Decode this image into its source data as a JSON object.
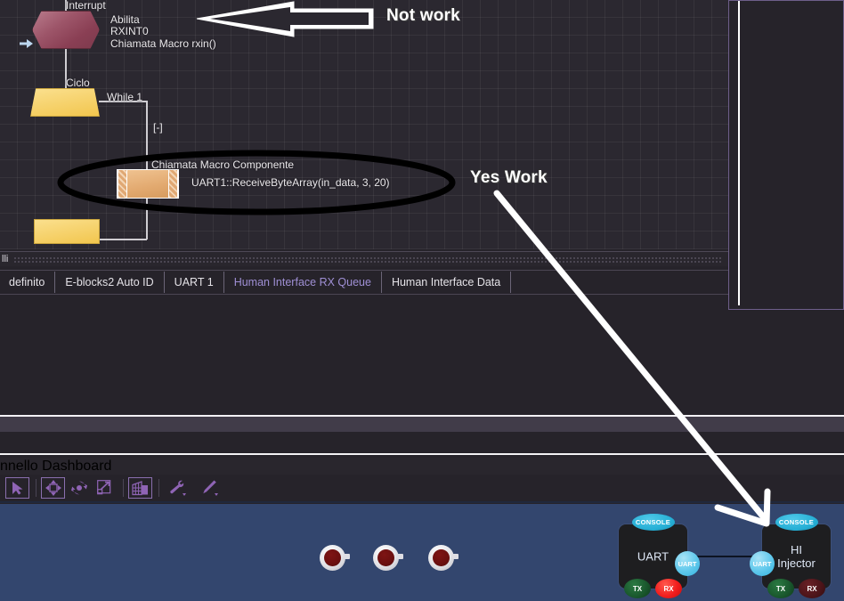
{
  "flowchart": {
    "nodes": [
      {
        "id": "interrupt",
        "shape": "hexagon",
        "caption": "Interrupt",
        "lines": [
          "Abilita",
          "RXINT0",
          "Chiamata Macro rxin()"
        ]
      },
      {
        "id": "loop-start",
        "shape": "trapezoid",
        "caption": "Ciclo",
        "condition": "While 1"
      },
      {
        "id": "macro-call",
        "shape": "component-box",
        "lines": [
          "Chiamata Macro Componente",
          "UART1::ReceiveByteArray(in_data, 3, 20)"
        ]
      },
      {
        "id": "loop-end",
        "shape": "bar",
        "caption": ""
      }
    ],
    "collapse_marker": "[-]",
    "cursor_marker": "➡"
  },
  "annotations": [
    {
      "id": "not-work",
      "text": "Not work",
      "arrow": "left"
    },
    {
      "id": "yes-work",
      "text": "Yes Work",
      "arrow": "down-right"
    }
  ],
  "panels": {
    "editor_strip_title": "lli",
    "dashboard_strip_title": "nnello Dashboard"
  },
  "tabs": [
    {
      "label": "definito",
      "active": false,
      "clipped": true
    },
    {
      "label": "E-blocks2 Auto ID",
      "active": false,
      "clipped": false
    },
    {
      "label": "UART 1",
      "active": false,
      "clipped": false
    },
    {
      "label": "Human Interface RX Queue",
      "active": true,
      "clipped": false
    },
    {
      "label": "Human Interface Data",
      "active": false,
      "clipped": false
    }
  ],
  "toolbar": {
    "buttons": [
      {
        "name": "select-tool",
        "icon": "cursor-arrow-icon",
        "boxed": true
      },
      {
        "name": "move-tool",
        "icon": "move-icon",
        "boxed": true
      },
      {
        "name": "rotate-tool",
        "icon": "rotate-icon",
        "boxed": false
      },
      {
        "name": "resize-tool",
        "icon": "resize-icon",
        "boxed": false
      },
      {
        "name": "panel-tool",
        "icon": "grid-panel-icon",
        "boxed": true
      },
      {
        "name": "properties-tool",
        "icon": "wrench-icon",
        "boxed": false
      },
      {
        "name": "appearance-tool",
        "icon": "brush-icon",
        "boxed": false
      }
    ]
  },
  "dashboard": {
    "leds": [
      {
        "name": "led-1",
        "state": "off",
        "color": "#6b0f0f"
      },
      {
        "name": "led-2",
        "state": "off",
        "color": "#6b0f0f"
      },
      {
        "name": "led-3",
        "state": "off",
        "color": "#6b0f0f"
      }
    ],
    "components": [
      {
        "id": "uart",
        "title": "UART",
        "badge": "CONSOLE",
        "port": "UART",
        "pins": [
          {
            "label": "TX",
            "state": "off",
            "color": "#19562c"
          },
          {
            "label": "RX",
            "state": "on",
            "color": "#f21d1d"
          }
        ]
      },
      {
        "id": "hi-injector",
        "title": "HI\nInjector",
        "title_line1": "HI",
        "title_line2": "Injector",
        "badge": "CONSOLE",
        "port": "UART",
        "pins": [
          {
            "label": "TX",
            "state": "off",
            "color": "#19562c"
          },
          {
            "label": "RX",
            "state": "off",
            "color": "#4b1419"
          }
        ]
      }
    ]
  },
  "colors": {
    "canvas_bg": "#2b2830",
    "panel_bg": "#26232a",
    "accent_purple": "#9f8fd4",
    "dashboard_bg": "#33466e",
    "interrupt_fill": "#9d5569",
    "loop_fill": "#f7d574",
    "macro_fill": "#e2a96f",
    "console_badge": "#27b0d6"
  }
}
